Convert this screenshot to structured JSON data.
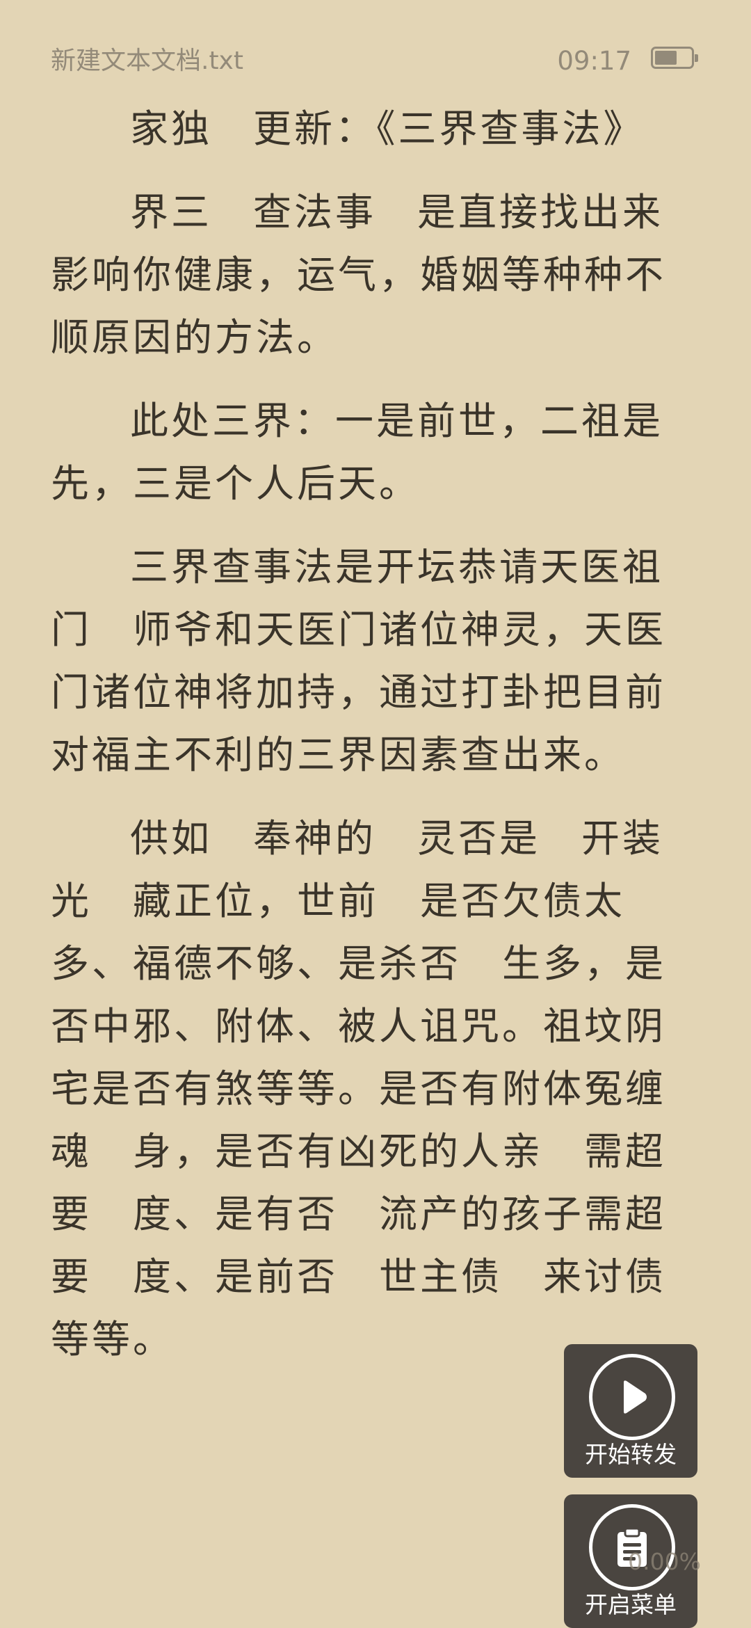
{
  "status": {
    "file_name": "新建文本文档.txt",
    "time": "09:17",
    "battery_level": 0.62
  },
  "paragraphs": [
    "家独　更新：《三界查事法》",
    "界三　查法事　是直接找出来影响你健康，运气，婚姻等种种不顺原因的方法。",
    "此处三界：一是前世，二祖是先，三是个人后天。",
    "三界查事法是开坛恭请天医祖门　师爷和天医门诸位神灵，天医门诸位神将加持，通过打卦把目前对福主不利的三界因素查出来。",
    "供如　奉神的　灵否是　开装光　藏正位，世前　是否欠债太多、福德不够、是杀否　生多，是否中邪、附体、被人诅咒。祖坟阴宅是否有煞等等。是否有附体冤缠魂　身，是否有凶死的人亲　需超要　度、是有否　流产的孩子需超要　度、是前否　世主债　来讨债等等。"
  ],
  "buttons": {
    "start_forward": {
      "label": "开始转发",
      "icon": "play-icon"
    },
    "open_menu": {
      "label": "开启菜单",
      "icon": "clipboard-icon"
    }
  },
  "progress": "0.00%"
}
